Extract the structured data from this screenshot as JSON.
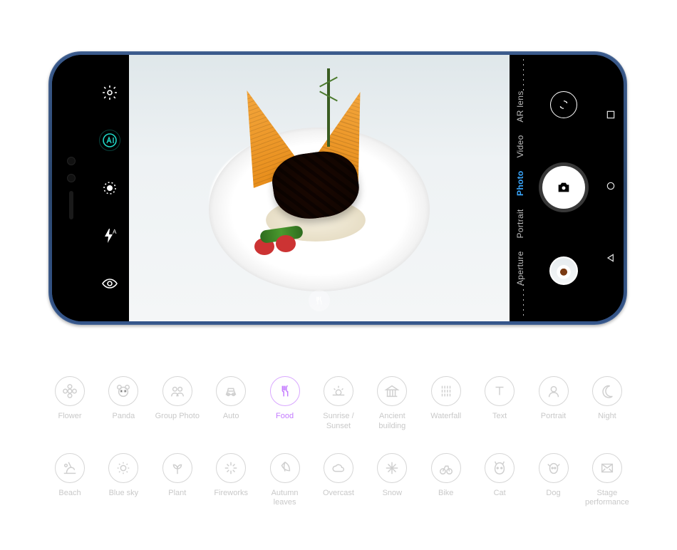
{
  "camera": {
    "modes": [
      "Aperture",
      "Portrait",
      "Photo",
      "Video",
      "AR lens"
    ],
    "active_mode": "Photo",
    "left_rail": {
      "settings": "gear-icon",
      "ai": "ai-icon",
      "live": "live-photo-icon",
      "flash": "flash-auto-icon",
      "beauty": "eye-icon"
    },
    "right_rail": {
      "swap": "camera-swap-icon",
      "shutter": "shutter-icon",
      "gallery": "gallery-thumbnail"
    },
    "nav_keys": [
      "square",
      "circle",
      "triangle"
    ],
    "detected_scene": "Food"
  },
  "ai_scenes": {
    "row1": [
      {
        "id": "flower",
        "label": "Flower"
      },
      {
        "id": "panda",
        "label": "Panda"
      },
      {
        "id": "group",
        "label": "Group Photo"
      },
      {
        "id": "auto",
        "label": "Auto"
      },
      {
        "id": "food",
        "label": "Food",
        "highlight": true
      },
      {
        "id": "sunrise",
        "label": "Sunrise /\nSunset"
      },
      {
        "id": "ancient",
        "label": "Ancient\nbuilding"
      },
      {
        "id": "waterfall",
        "label": "Waterfall"
      },
      {
        "id": "text",
        "label": "Text"
      },
      {
        "id": "portrait",
        "label": "Portrait"
      },
      {
        "id": "night",
        "label": "Night"
      }
    ],
    "row2": [
      {
        "id": "beach",
        "label": "Beach"
      },
      {
        "id": "bluesky",
        "label": "Blue sky"
      },
      {
        "id": "plant",
        "label": "Plant"
      },
      {
        "id": "fireworks",
        "label": "Fireworks"
      },
      {
        "id": "leaves",
        "label": "Autumn leaves"
      },
      {
        "id": "overcast",
        "label": "Overcast"
      },
      {
        "id": "snow",
        "label": "Snow"
      },
      {
        "id": "bike",
        "label": "Bike"
      },
      {
        "id": "cat",
        "label": "Cat"
      },
      {
        "id": "dog",
        "label": "Dog"
      },
      {
        "id": "stage",
        "label": "Stage\nperformance"
      }
    ]
  }
}
